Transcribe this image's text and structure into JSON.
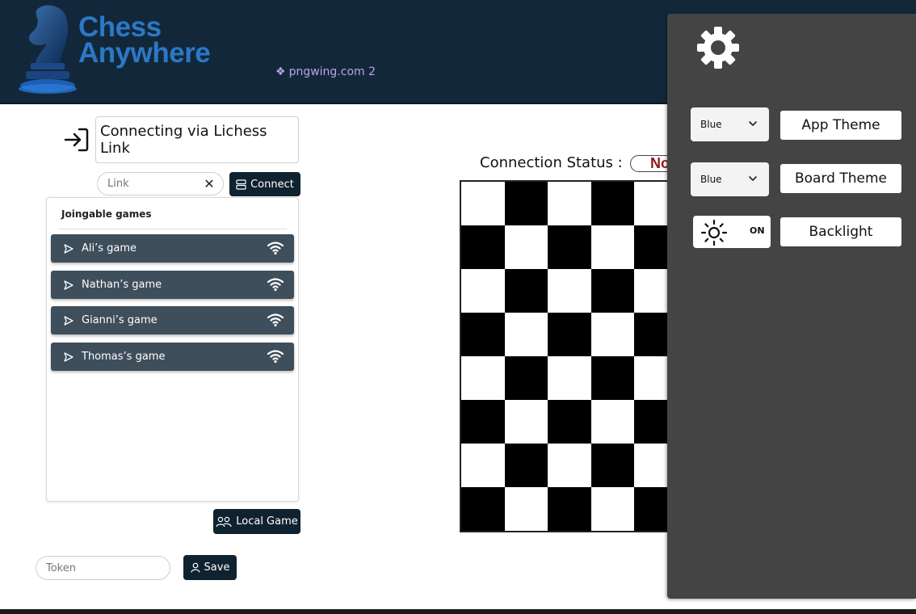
{
  "header": {
    "app_name_line1": "Chess",
    "app_name_line2": "Anywhere",
    "watermark_icon": "❖",
    "watermark_text": "pngwing.com 2"
  },
  "connection": {
    "title": "Connecting via Lichess Link",
    "link_placeholder": "Link",
    "clear_symbol": "✕",
    "connect_label": "Connect"
  },
  "games": {
    "header": "Joingable games",
    "items": [
      {
        "label": "Ali’s game"
      },
      {
        "label": "Nathan’s game"
      },
      {
        "label": "Gianni’s game"
      },
      {
        "label": "Thomas’s game"
      }
    ]
  },
  "local_game_label": "Local Game",
  "token": {
    "placeholder": "Token",
    "save_label": "Save"
  },
  "board": {
    "status_label": "Connection  Status  :",
    "status_value": "No"
  },
  "settings": {
    "app_theme": {
      "value": "Blue",
      "label": "App Theme"
    },
    "board_theme": {
      "value": "Blue",
      "label": "Board Theme"
    },
    "backlight": {
      "state": "ON",
      "label": "Backlight"
    }
  },
  "colors": {
    "header_bg": "#12283a",
    "logo_blue": "#2b78c6",
    "button_dark": "#0f2230",
    "game_item_bg": "#3e4e5b",
    "settings_bg": "#444444",
    "status_red": "#8b1a1a"
  }
}
